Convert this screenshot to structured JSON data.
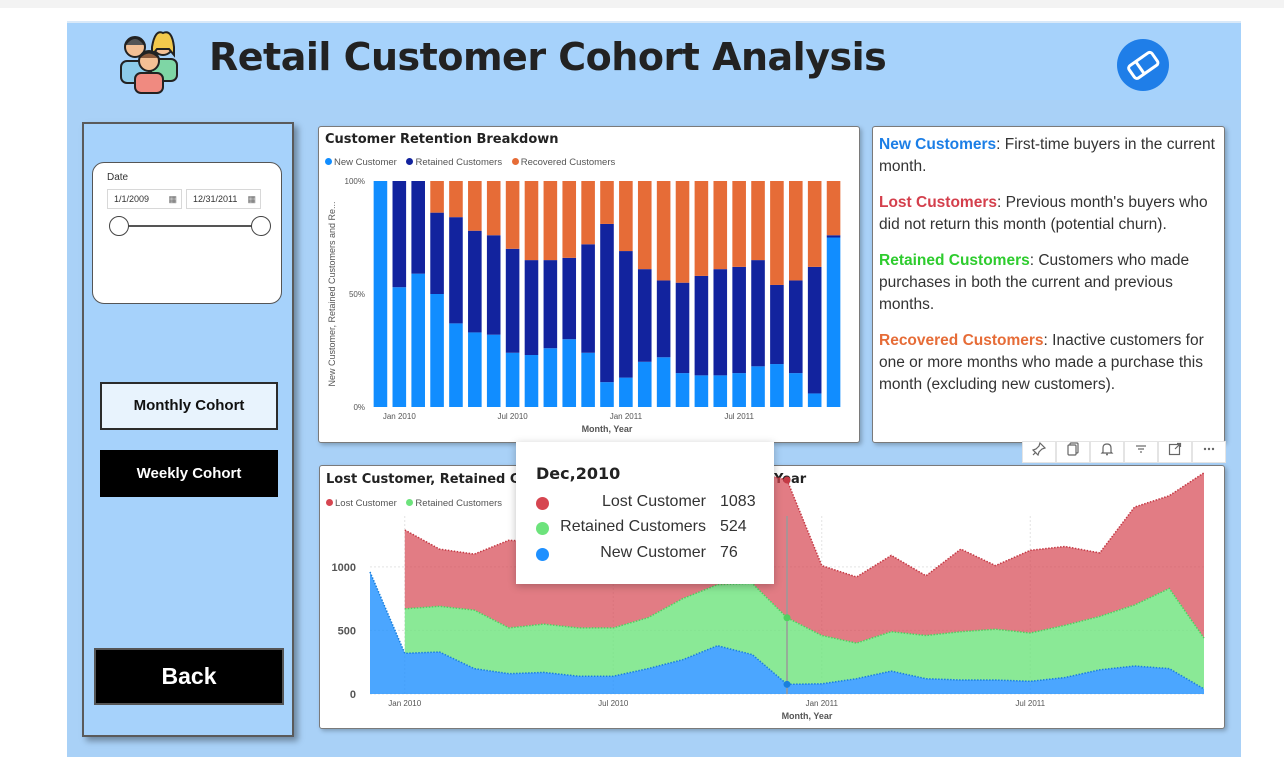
{
  "header": {
    "title": "Retail Customer Cohort Analysis"
  },
  "icons": {
    "people": "people-group-icon",
    "eraser": "eraser-icon",
    "calendar": "calendar-icon",
    "pin": "pin-icon",
    "copy": "copy-icon",
    "bell": "bell-icon",
    "filter": "filter-icon",
    "focus": "focus-mode-icon",
    "more": "more-options-icon"
  },
  "sidebar": {
    "slicer": {
      "title": "Date",
      "start_date": "1/1/2009",
      "end_date": "12/31/2011"
    },
    "monthly_label": "Monthly Cohort",
    "weekly_label": "Weekly Cohort",
    "back_label": "Back"
  },
  "info": {
    "new_term": "New Customers",
    "new_desc": ": First-time buyers in the current month.",
    "lost_term": "Lost Customers",
    "lost_desc": ": Previous month's buyers who did not return this month (potential churn).",
    "retained_term": "Retained Customers",
    "retained_desc": ": Customers who made purchases in both the current and previous months.",
    "recovered_term": "Recovered Customers",
    "recovered_desc": ": Inactive customers for one or more months who made a purchase this month (excluding new customers)."
  },
  "colors": {
    "new_customer": "#118dff",
    "retained_customers": "#12239e",
    "recovered_customers": "#e66c37",
    "lost_customer": "#d64550",
    "retained_area": "#6de37c",
    "new_area": "#1e90ff",
    "info_new": "#1b7ee6",
    "info_lost": "#d43f4c",
    "info_retained": "#2ecc2e",
    "info_recovered": "#e66c37"
  },
  "tooltip": {
    "title": "Dec,2010",
    "rows": [
      {
        "label": "Lost Customer",
        "value": "1083"
      },
      {
        "label": "Retained Customers",
        "value": "524"
      },
      {
        "label": "New Customer",
        "value": "76"
      }
    ]
  },
  "chart_data": [
    {
      "type": "bar",
      "stacked": "100%",
      "title": "Customer Retention Breakdown",
      "xlabel": "Month, Year",
      "ylabel": "New Customer, Retained Customers and Re...",
      "ylim": [
        0,
        100
      ],
      "yticks": [
        "0%",
        "50%",
        "100%"
      ],
      "xticks": [
        "Jan 2010",
        "Jul 2010",
        "Jan 2011",
        "Jul 2011"
      ],
      "categories": [
        "Dec 2009",
        "Jan 2010",
        "Feb 2010",
        "Mar 2010",
        "Apr 2010",
        "May 2010",
        "Jun 2010",
        "Jul 2010",
        "Aug 2010",
        "Sep 2010",
        "Oct 2010",
        "Nov 2010",
        "Dec 2010",
        "Jan 2011",
        "Feb 2011",
        "Mar 2011",
        "Apr 2011",
        "May 2011",
        "Jun 2011",
        "Jul 2011",
        "Aug 2011",
        "Sep 2011",
        "Oct 2011",
        "Nov 2011",
        "Dec 2011"
      ],
      "series": [
        {
          "name": "New Customer",
          "values": [
            100,
            53,
            59,
            50,
            37,
            33,
            32,
            24,
            23,
            26,
            30,
            24,
            11,
            13,
            20,
            22,
            15,
            14,
            14,
            15,
            18,
            19,
            15,
            6,
            75
          ]
        },
        {
          "name": "Retained Customers",
          "values": [
            0,
            47,
            41,
            36,
            47,
            45,
            44,
            46,
            42,
            39,
            36,
            48,
            70,
            56,
            41,
            34,
            40,
            44,
            47,
            47,
            47,
            35,
            41,
            56,
            1
          ]
        },
        {
          "name": "Recovered Customers",
          "values": [
            0,
            0,
            0,
            14,
            16,
            22,
            24,
            30,
            35,
            35,
            34,
            28,
            19,
            31,
            39,
            44,
            45,
            42,
            39,
            38,
            35,
            46,
            44,
            38,
            24
          ]
        }
      ],
      "legend": "top-left"
    },
    {
      "type": "area",
      "title": "Lost Customer, Retained Customers and New Customer by Month, Year",
      "title_visible": "Lost Customer, Retained Cus",
      "title_visible_tail": "Year",
      "xlabel": "Month, Year",
      "ylabel": "",
      "ylim": [
        0,
        1400
      ],
      "yticks": [
        "0",
        "500",
        "1000"
      ],
      "xticks": [
        "Jan 2010",
        "Jul 2010",
        "Jan 2011",
        "Jul 2011"
      ],
      "categories": [
        "Dec 2009",
        "Jan 2010",
        "Feb 2010",
        "Mar 2010",
        "Apr 2010",
        "May 2010",
        "Jun 2010",
        "Jul 2010",
        "Aug 2010",
        "Sep 2010",
        "Oct 2010",
        "Nov 2010",
        "Dec 2010",
        "Jan 2011",
        "Feb 2011",
        "Mar 2011",
        "Apr 2011",
        "May 2011",
        "Jun 2011",
        "Jul 2011",
        "Aug 2011",
        "Sep 2011",
        "Oct 2011",
        "Nov 2011",
        "Dec 2011"
      ],
      "series": [
        {
          "name": "Lost Customer",
          "values": [
            0,
            620,
            450,
            440,
            690,
            640,
            620,
            660,
            580,
            700,
            780,
            880,
            1083,
            550,
            520,
            600,
            470,
            650,
            500,
            650,
            620,
            500,
            770,
            730,
            1300
          ]
        },
        {
          "name": "Retained Customers",
          "values": [
            0,
            350,
            360,
            460,
            360,
            380,
            380,
            380,
            400,
            480,
            480,
            560,
            524,
            380,
            280,
            310,
            340,
            380,
            400,
            380,
            410,
            420,
            480,
            630,
            400
          ]
        },
        {
          "name": "New Customer",
          "values": [
            960,
            320,
            330,
            200,
            160,
            170,
            140,
            140,
            200,
            270,
            380,
            310,
            76,
            80,
            120,
            180,
            120,
            110,
            110,
            100,
            130,
            190,
            220,
            200,
            40
          ]
        }
      ],
      "legend": "top-left",
      "legend_visible": [
        "Lost Customer",
        "Retained Customers"
      ],
      "highlighted": "Dec 2010"
    }
  ]
}
